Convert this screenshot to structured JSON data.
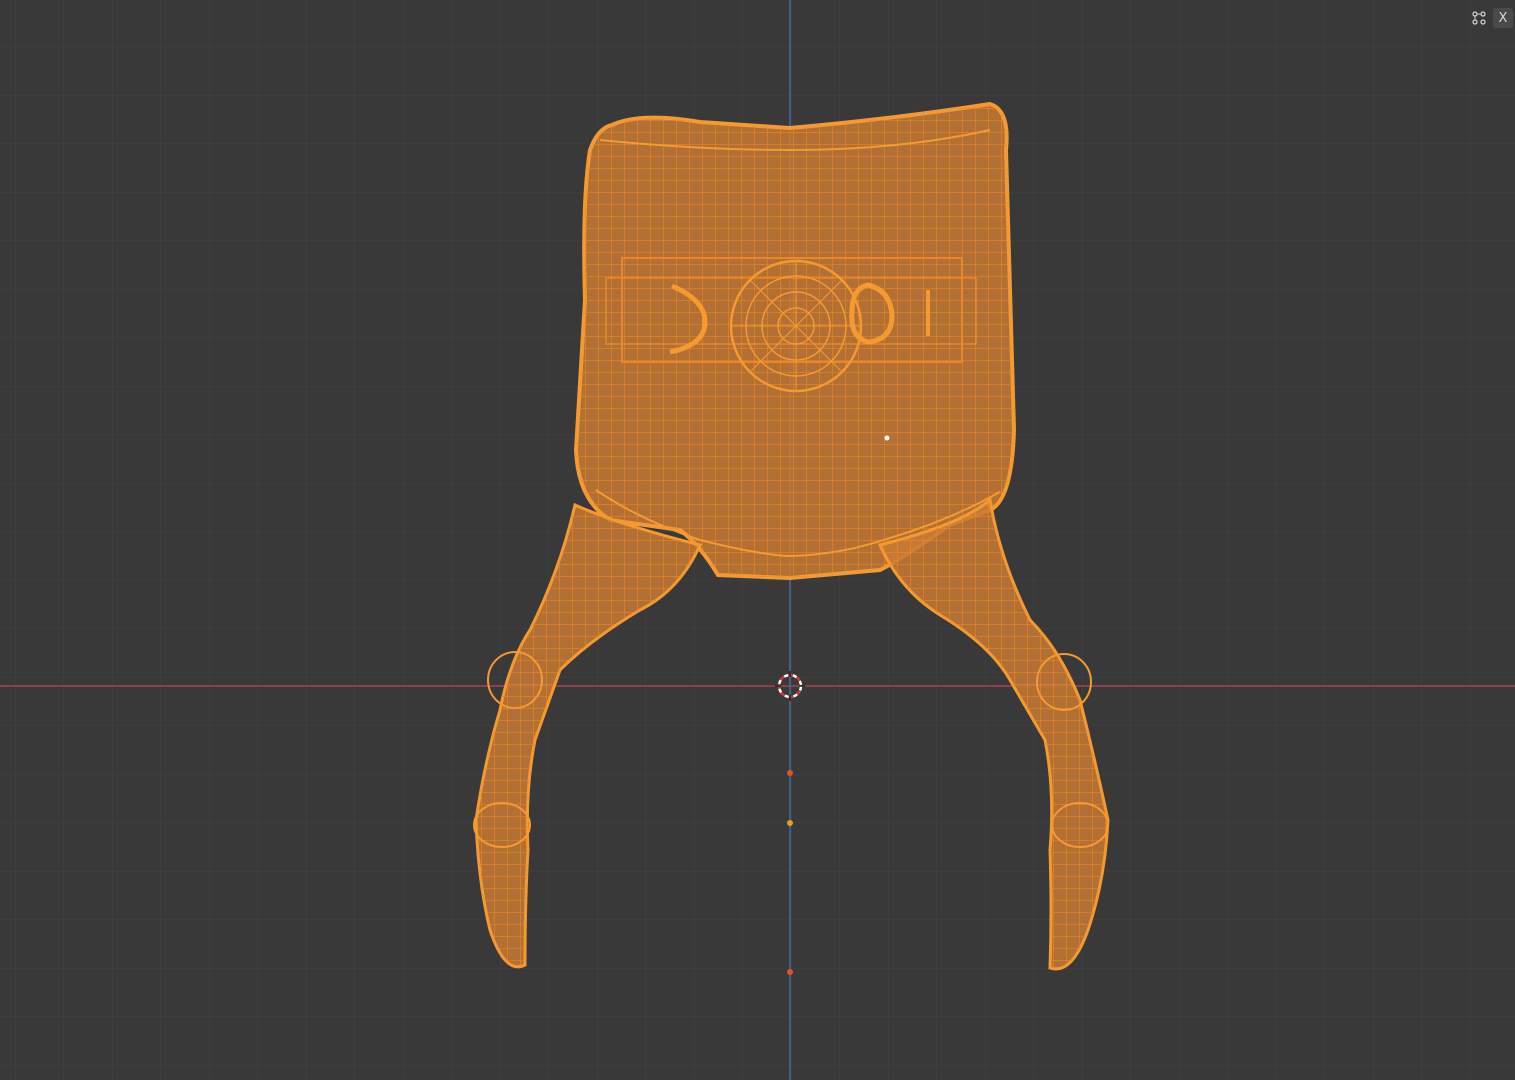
{
  "viewport": {
    "mode": "wireframe",
    "colors": {
      "background": "#393939",
      "grid_minor": "#444444",
      "grid_major": "#4c4c4c",
      "axis_x": "#b04a55",
      "axis_y": "#4a74a8",
      "selection": "#f0902a",
      "mesh_fill": "#f2913a"
    },
    "object": "chair-mesh",
    "cursor_3d": "3d-cursor-icon"
  },
  "corner": {
    "icon": "view-options-icon",
    "close_label": "X"
  }
}
